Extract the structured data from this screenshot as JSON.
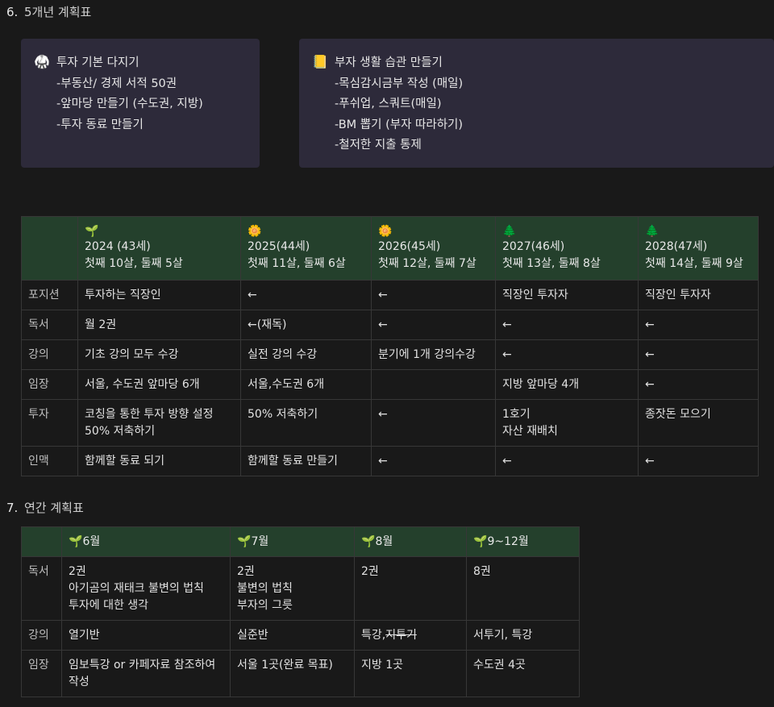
{
  "section6": {
    "number": "6.",
    "title": "5개년 계획표"
  },
  "callout1": {
    "icon": "martial-arts-uniform-icon",
    "lines": [
      "투자 기본 다지기",
      "-부동산/ 경제 서적 50권",
      "-앞마당 만들기 (수도권, 지방)",
      "-투자 동료 만들기"
    ]
  },
  "callout2": {
    "icon": "ledger-icon",
    "lines": [
      "부자 생활 습관 만들기",
      "-목심감시금부 작성 (매일)",
      "-푸쉬업, 스쿼트(매일)",
      "-BM 뽑기 (부자 따라하기)",
      "-철저한 지출 통제"
    ]
  },
  "plan5": {
    "headers": [
      {
        "icon": "🌱",
        "icon_name": "seedling-icon",
        "year": "2024 (43세)",
        "ages": "첫째 10살, 둘째 5살"
      },
      {
        "icon": "🌼",
        "icon_name": "blossom-icon",
        "year": "2025(44세)",
        "ages": "첫째 11살, 둘째 6살"
      },
      {
        "icon": "🌼",
        "icon_name": "blossom-icon",
        "year": "2026(45세)",
        "ages": "첫째 12살, 둘째 7살"
      },
      {
        "icon": "🌲",
        "icon_name": "evergreen-tree-icon",
        "year": "2027(46세)",
        "ages": "첫째 13살, 둘째 8살"
      },
      {
        "icon": "🌲",
        "icon_name": "evergreen-tree-icon",
        "year": "2028(47세)",
        "ages": "첫째 14살, 둘째 9살"
      }
    ],
    "rows": [
      {
        "label": "포지션",
        "cells": [
          [
            "투자하는 직장인"
          ],
          [
            "←"
          ],
          [
            "←"
          ],
          [
            "직장인 투자자"
          ],
          [
            "직장인 투자자"
          ]
        ]
      },
      {
        "label": "독서",
        "cells": [
          [
            "월 2권"
          ],
          [
            "←(재독)"
          ],
          [
            "←"
          ],
          [
            "←"
          ],
          [
            "←"
          ]
        ]
      },
      {
        "label": "강의",
        "cells": [
          [
            "기초 강의 모두 수강"
          ],
          [
            "실전 강의 수강"
          ],
          [
            "분기에 1개 강의수강"
          ],
          [
            "←"
          ],
          [
            "←"
          ]
        ]
      },
      {
        "label": "임장",
        "cells": [
          [
            "서울, 수도권 앞마당 6개"
          ],
          [
            "서울,수도권 6개"
          ],
          [
            ""
          ],
          [
            "지방 앞마당 4개"
          ],
          [
            "←"
          ]
        ]
      },
      {
        "label": "투자",
        "cells": [
          [
            "코칭을 통한 투자 방향 설정",
            "50% 저축하기"
          ],
          [
            "50% 저축하기"
          ],
          [
            "←"
          ],
          [
            "1호기",
            "자산 재배치"
          ],
          [
            "종잣돈 모으기"
          ]
        ]
      },
      {
        "label": "인맥",
        "cells": [
          [
            "함께할 동료 되기"
          ],
          [
            "함께할 동료 만들기"
          ],
          [
            "←"
          ],
          [
            "←"
          ],
          [
            "←"
          ]
        ]
      }
    ]
  },
  "section7": {
    "number": "7.",
    "title": "연간 계획표"
  },
  "annual": {
    "icon": "🌱",
    "icon_name": "seedling-icon",
    "headers": [
      "6월",
      "7월",
      "8월",
      "9~12월"
    ],
    "rows": [
      {
        "label": "독서",
        "cells": [
          [
            "2권",
            "아기곰의 재태크 불변의 법칙",
            "투자에 대한 생각"
          ],
          [
            "2권",
            "불변의 법칙",
            "부자의 그릇"
          ],
          [
            "2권"
          ],
          [
            "8권"
          ]
        ]
      },
      {
        "label": "강의",
        "cells": [
          [
            "열기반"
          ],
          [
            "실준반"
          ],
          [
            "특강,",
            "지투기"
          ],
          [
            "서투기, 특강"
          ]
        ]
      },
      {
        "label": "임장",
        "cells": [
          [
            "임보특강 or 카페자료 참조하여",
            "작성"
          ],
          [
            "서울 1곳(완료 목표)"
          ],
          [
            "지방 1곳"
          ],
          [
            "수도권 4곳"
          ]
        ]
      }
    ]
  }
}
